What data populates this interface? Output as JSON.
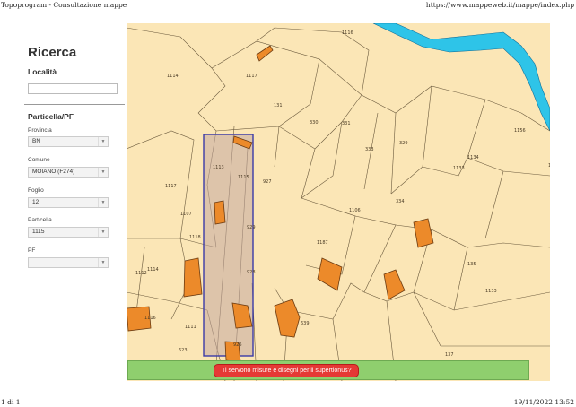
{
  "print": {
    "title": "Topoprogram - Consultazione mappe",
    "url": "https://www.mappeweb.it/mappe/index.php",
    "page": "1 di 1",
    "datetime": "19/11/2022 13:52"
  },
  "sidebar": {
    "title": "Ricerca",
    "locality_label": "Località",
    "locality_value": "",
    "section": "Particella/PF",
    "provincia_label": "Provincia",
    "provincia_value": "BN",
    "comune_label": "Comune",
    "comune_value": "MOIANO (F274)",
    "foglio_label": "Foglio",
    "foglio_value": "12",
    "particella_label": "Particella",
    "particella_value": "1115",
    "pf_label": "PF",
    "pf_value": ""
  },
  "map": {
    "parcel_labels": [
      "1116",
      "1114",
      "1117",
      "131",
      "330",
      "331",
      "333",
      "329",
      "334",
      "1133",
      "1134",
      "1156",
      "1106",
      "135",
      "1117",
      "1107",
      "927",
      "1118",
      "1187",
      "1112",
      "1114",
      "1133",
      "1116",
      "1111",
      "1113",
      "1115",
      "928",
      "929",
      "926",
      "639",
      "623",
      "137",
      "109"
    ],
    "selection_color": "#3a3aa8",
    "building_color": "#ec8a2a",
    "river_color": "#2ec4e8"
  },
  "banner": {
    "message": "Ti servono misure e disegni per il supertionus?"
  }
}
